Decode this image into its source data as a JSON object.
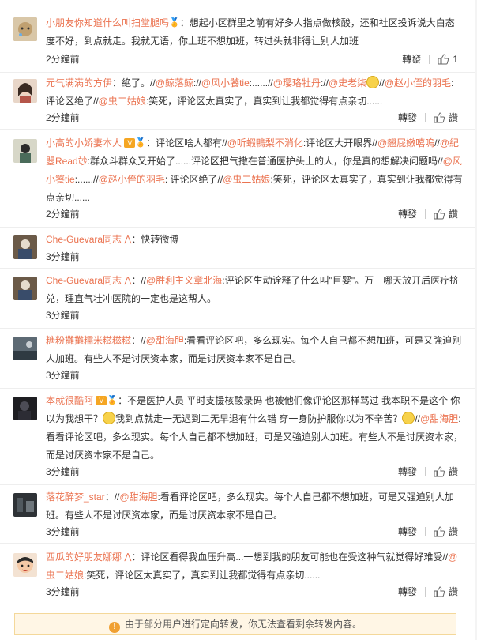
{
  "labels": {
    "forward": "轉發",
    "like": "讚",
    "like_count_first": "1"
  },
  "notice": "由于部分用户进行定向转发，你无法查看剩余转发内容。",
  "items": [
    {
      "user": "小朋友你知道什么叫扫堂腿吗",
      "text_a": "：想起小区群里之前有好多人指点做核酸，还和社区投诉说大白态度不好，到点就走。我就无语，你上班不想加班，转过头就非得让别人加班",
      "time": "2分鐘前"
    },
    {
      "user": "元气满满的方伊",
      "text_a": "：絶了。//",
      "m1": "@鲸落鲸",
      "t1": "://",
      "m2": "@风小饕tie",
      "t2": ":......//",
      "m3": "@璎珞牡丹",
      "t3": "://",
      "m4": "@史老柒",
      "t4": "//",
      "m5": "@赵小侄的羽毛",
      "t5": ": 评论区绝了//",
      "m6": "@虫二姑娘",
      "t6": ":笑死，评论区太真实了，真实到让我都觉得有点亲切......",
      "time": "2分鐘前"
    },
    {
      "user": "小高的小娇妻本人",
      "text_a": "：评论区啥人都有//",
      "m1": "@听蝦鴨梨不消化",
      "t1": ":评论区大开眼界//",
      "m2": "@翘屁嫩嘻嗚",
      "t2": "//",
      "m3": "@紀曌Read竗",
      "t3": ":群众斗群众又开始了......评论区把气撒在普通医护头上的人，你是真的想解决问题吗//",
      "m4": "@风小饕tie",
      "t4": ":......//",
      "m5": "@赵小侄的羽毛",
      "t5": ": 评论区绝了//",
      "m6": "@虫二姑娘",
      "t6": ":笑死，评论区太真实了，真实到让我都觉得有点亲切......",
      "time": "2分鐘前"
    },
    {
      "user": "Che-Guevara同志",
      "text_a": "：快转微博",
      "time": "3分鐘前"
    },
    {
      "user": "Che-Guevara同志",
      "text_a": "：//",
      "m1": "@胜利主义章北海",
      "t1": ":评论区生动诠释了什么叫\"巨婴\"。万一哪天放开后医疗挤兑，理直气壮冲医院的一定也是这帮人。",
      "time": "3分鐘前"
    },
    {
      "user": "糖粉攤攤糯米糍糍糍",
      "text_a": "：//",
      "m1": "@甜海胆",
      "t1": ":看看评论区吧，多么现实。每个人自己都不想加班，可是又強迫别人加班。有些人不是讨厌资本家，而是讨厌资本家不是自己。",
      "time": "3分鐘前"
    },
    {
      "user": "本就很酷阿",
      "text_a": "：不是医护人员 平时支援核酸录码 也被他们像评论区那样骂过 我本职不是这个 你以为我想干？",
      "text_b": "我到点就走一无迟到二无早退有什么错 穿一身防护服你以为不辛苦？",
      "m1": "@甜海胆",
      "t1": ":看看评论区吧，多么现实。每个人自己都不想加班，可是又強迫别人加班。有些人不是讨厌资本家，而是讨厌资本家不是自己。",
      "time": "3分鐘前"
    },
    {
      "user": "落花醉梦_star",
      "text_a": "：//",
      "m1": "@甜海胆",
      "t1": ":看看评论区吧，多么现实。每个人自己都不想加班，可是又强迫别人加班。有些人不是讨厌资本家，而是讨厌资本家不是自己。",
      "time": "3分鐘前"
    },
    {
      "user": "西瓜的好朋友娜娜",
      "text_a": "：评论区看得我血压升高...一想到我的朋友可能也在受这种气就觉得好难受//",
      "m1": "@虫二姑娘",
      "t1": ":笑死，评论区太真实了，真实到让我都觉得有点亲切......",
      "time": "3分鐘前"
    }
  ],
  "colors": {
    "accent": "#eb7350",
    "notice_bg": "#fff6e5"
  }
}
